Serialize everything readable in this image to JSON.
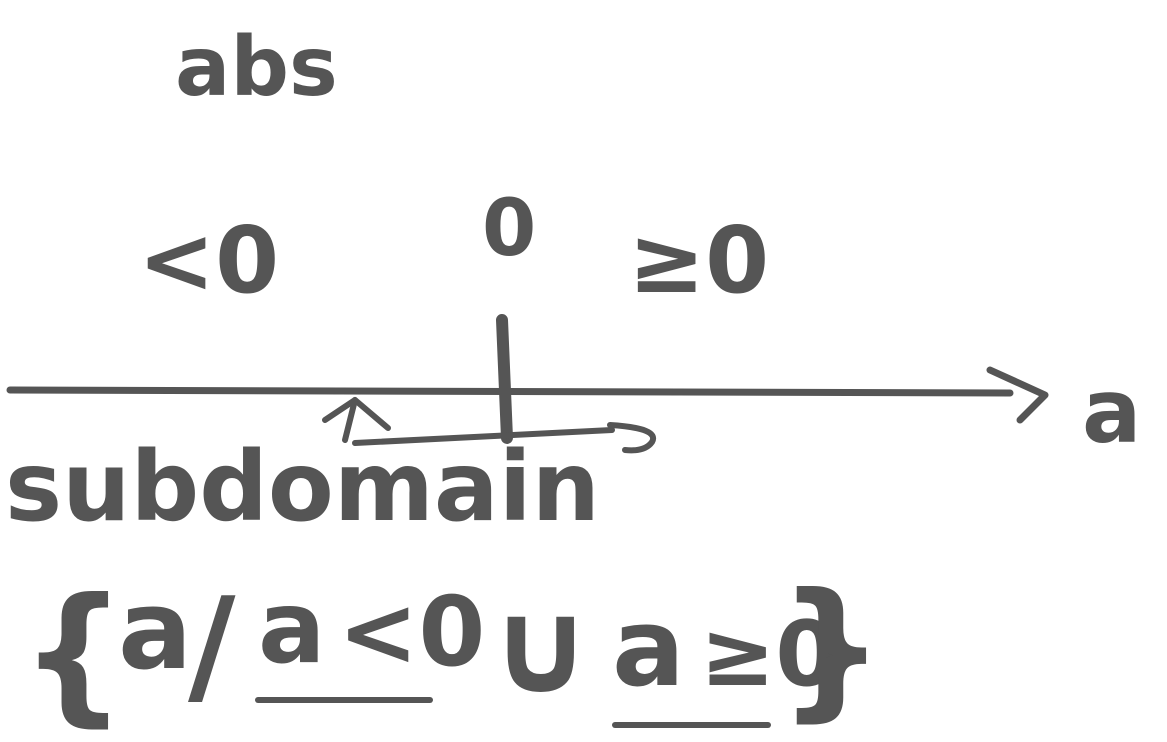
{
  "diagram": {
    "title": "abs",
    "labels": {
      "negative": "<0",
      "zero": "0",
      "nonnegative": "≥0",
      "axis": "a",
      "subdomain": "subdomain"
    },
    "set_notation": {
      "open_brace": "{",
      "variable": "a",
      "separator": "/",
      "left_condition_var": "a",
      "left_condition_op": "<0",
      "union": "∪",
      "right_condition_var": "a",
      "right_condition_op": "≥0",
      "close_brace": "}"
    },
    "colors": {
      "ink": "#555555",
      "background": "#ffffff"
    }
  }
}
